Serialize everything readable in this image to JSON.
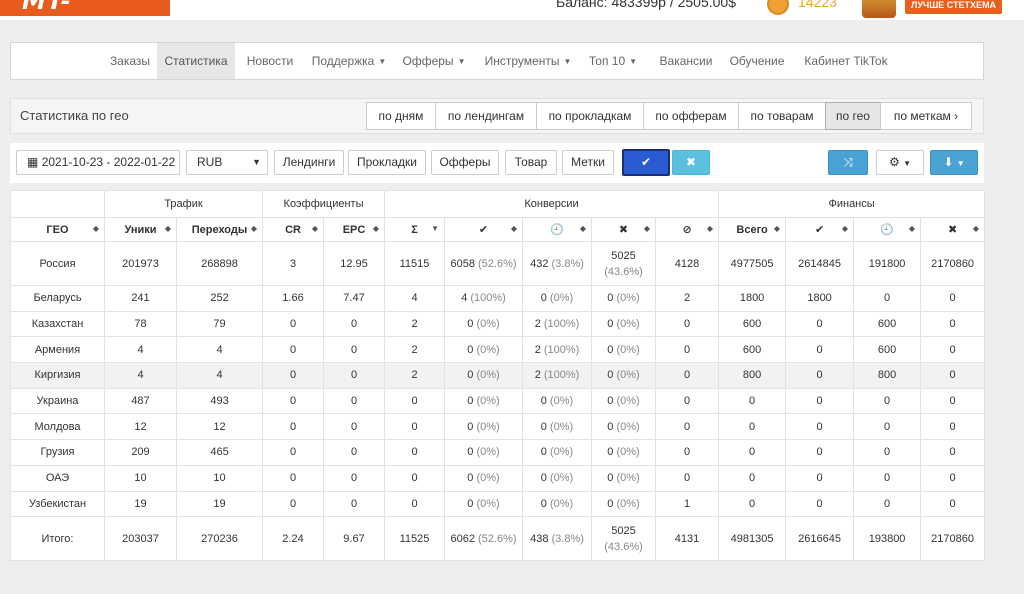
{
  "header": {
    "logo": "MT-SHOP.RU",
    "balance": "Баланс: 483399р / 2505.00$",
    "points": "14223",
    "badge": "ЛУЧШЕ СТЕТХЕМА"
  },
  "nav": {
    "items": [
      {
        "label": "Заказы"
      },
      {
        "label": "Статистика"
      },
      {
        "label": "Новости"
      },
      {
        "label": "Поддержка"
      },
      {
        "label": "Офферы"
      },
      {
        "label": "Инструменты"
      },
      {
        "label": "Топ 10"
      },
      {
        "label": "Вакансии"
      },
      {
        "label": "Обучение"
      },
      {
        "label": "Кабинет TikTok"
      }
    ]
  },
  "panel": {
    "title": "Статистика по гео",
    "segments": [
      "по дням",
      "по лендингам",
      "по прокладкам",
      "по офферам",
      "по товарам",
      "по гео",
      "по меткам"
    ]
  },
  "toolbar": {
    "date_range": "2021-10-23 - 2022-01-22",
    "currency": "RUB",
    "buttons": [
      "Лендинги",
      "Прокладки",
      "Офферы",
      "Товар",
      "Метки"
    ]
  },
  "table": {
    "groups": [
      "Трафик",
      "Коэффициенты",
      "Конверсии",
      "Финансы"
    ],
    "columns": [
      "ГЕО",
      "Уники",
      "Переходы",
      "CR",
      "EPC",
      "Σ",
      "✔",
      "🕘",
      "✖",
      "⊘",
      "Всего",
      "✔",
      "🕘",
      "✖"
    ],
    "rows": [
      {
        "geo": "Россия",
        "uniq": "201973",
        "clicks": "268898",
        "cr": "3",
        "epc": "12.95",
        "sum": "11515",
        "ok": "6058",
        "ok_p": "(52.6%)",
        "hold": "432",
        "hold_p": "(3.8%)",
        "rej": "5025",
        "rej_p": "(43.6%)",
        "trash": "4128",
        "total": "4977505",
        "f_ok": "2614845",
        "f_hold": "191800",
        "f_rej": "2170860"
      },
      {
        "geo": "Беларусь",
        "uniq": "241",
        "clicks": "252",
        "cr": "1.66",
        "epc": "7.47",
        "sum": "4",
        "ok": "4",
        "ok_p": "(100%)",
        "hold": "0",
        "hold_p": "(0%)",
        "rej": "0",
        "rej_p": "(0%)",
        "trash": "2",
        "total": "1800",
        "f_ok": "1800",
        "f_hold": "0",
        "f_rej": "0"
      },
      {
        "geo": "Казахстан",
        "uniq": "78",
        "clicks": "79",
        "cr": "0",
        "epc": "0",
        "sum": "2",
        "ok": "0",
        "ok_p": "(0%)",
        "hold": "2",
        "hold_p": "(100%)",
        "rej": "0",
        "rej_p": "(0%)",
        "trash": "0",
        "total": "600",
        "f_ok": "0",
        "f_hold": "600",
        "f_rej": "0"
      },
      {
        "geo": "Армения",
        "uniq": "4",
        "clicks": "4",
        "cr": "0",
        "epc": "0",
        "sum": "2",
        "ok": "0",
        "ok_p": "(0%)",
        "hold": "2",
        "hold_p": "(100%)",
        "rej": "0",
        "rej_p": "(0%)",
        "trash": "0",
        "total": "600",
        "f_ok": "0",
        "f_hold": "600",
        "f_rej": "0"
      },
      {
        "geo": "Киргизия",
        "uniq": "4",
        "clicks": "4",
        "cr": "0",
        "epc": "0",
        "sum": "2",
        "ok": "0",
        "ok_p": "(0%)",
        "hold": "2",
        "hold_p": "(100%)",
        "rej": "0",
        "rej_p": "(0%)",
        "trash": "0",
        "total": "800",
        "f_ok": "0",
        "f_hold": "800",
        "f_rej": "0"
      },
      {
        "geo": "Украина",
        "uniq": "487",
        "clicks": "493",
        "cr": "0",
        "epc": "0",
        "sum": "0",
        "ok": "0",
        "ok_p": "(0%)",
        "hold": "0",
        "hold_p": "(0%)",
        "rej": "0",
        "rej_p": "(0%)",
        "trash": "0",
        "total": "0",
        "f_ok": "0",
        "f_hold": "0",
        "f_rej": "0"
      },
      {
        "geo": "Молдова",
        "uniq": "12",
        "clicks": "12",
        "cr": "0",
        "epc": "0",
        "sum": "0",
        "ok": "0",
        "ok_p": "(0%)",
        "hold": "0",
        "hold_p": "(0%)",
        "rej": "0",
        "rej_p": "(0%)",
        "trash": "0",
        "total": "0",
        "f_ok": "0",
        "f_hold": "0",
        "f_rej": "0"
      },
      {
        "geo": "Грузия",
        "uniq": "209",
        "clicks": "465",
        "cr": "0",
        "epc": "0",
        "sum": "0",
        "ok": "0",
        "ok_p": "(0%)",
        "hold": "0",
        "hold_p": "(0%)",
        "rej": "0",
        "rej_p": "(0%)",
        "trash": "0",
        "total": "0",
        "f_ok": "0",
        "f_hold": "0",
        "f_rej": "0"
      },
      {
        "geo": "ОАЭ",
        "uniq": "10",
        "clicks": "10",
        "cr": "0",
        "epc": "0",
        "sum": "0",
        "ok": "0",
        "ok_p": "(0%)",
        "hold": "0",
        "hold_p": "(0%)",
        "rej": "0",
        "rej_p": "(0%)",
        "trash": "0",
        "total": "0",
        "f_ok": "0",
        "f_hold": "0",
        "f_rej": "0"
      },
      {
        "geo": "Узбекистан",
        "uniq": "19",
        "clicks": "19",
        "cr": "0",
        "epc": "0",
        "sum": "0",
        "ok": "0",
        "ok_p": "(0%)",
        "hold": "0",
        "hold_p": "(0%)",
        "rej": "0",
        "rej_p": "(0%)",
        "trash": "1",
        "total": "0",
        "f_ok": "0",
        "f_hold": "0",
        "f_rej": "0"
      }
    ],
    "total": {
      "geo": "Итого:",
      "uniq": "203037",
      "clicks": "270236",
      "cr": "2.24",
      "epc": "9.67",
      "sum": "11525",
      "ok": "6062",
      "ok_p": "(52.6%)",
      "hold": "438",
      "hold_p": "(3.8%)",
      "rej": "5025",
      "rej_p": "(43.6%)",
      "trash": "4131",
      "total": "4981305",
      "f_ok": "2616645",
      "f_hold": "193800",
      "f_rej": "2170860"
    }
  }
}
